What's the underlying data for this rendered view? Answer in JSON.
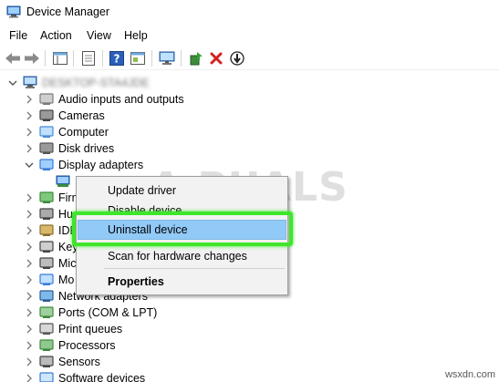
{
  "window": {
    "title": "Device Manager"
  },
  "menu": [
    "File",
    "Action",
    "View",
    "Help"
  ],
  "tree": {
    "root_label": "DESKTOP-STA4JDE",
    "items": [
      {
        "label": "Audio inputs and outputs",
        "icon": "speaker-icon"
      },
      {
        "label": "Cameras",
        "icon": "camera-icon"
      },
      {
        "label": "Computer",
        "icon": "computer-icon"
      },
      {
        "label": "Disk drives",
        "icon": "disk-drive-icon"
      },
      {
        "label": "Display adapters",
        "icon": "display-adapter-icon",
        "expanded": true
      },
      {
        "label": "Firm",
        "icon": "firmware-icon"
      },
      {
        "label": "Hu",
        "icon": "hid-icon"
      },
      {
        "label": "IDE",
        "icon": "ide-icon"
      },
      {
        "label": "Key",
        "icon": "keyboard-icon"
      },
      {
        "label": "Mic",
        "icon": "mice-icon"
      },
      {
        "label": "Mo",
        "icon": "monitor-icon"
      },
      {
        "label": "Network adapters",
        "icon": "network-adapter-icon"
      },
      {
        "label": "Ports (COM & LPT)",
        "icon": "port-icon"
      },
      {
        "label": "Print queues",
        "icon": "printer-icon"
      },
      {
        "label": "Processors",
        "icon": "processor-icon"
      },
      {
        "label": "Sensors",
        "icon": "sensor-icon"
      },
      {
        "label": "Software devices",
        "icon": "software-device-icon"
      }
    ]
  },
  "context_menu": {
    "items": [
      "Update driver",
      "Disable device",
      "Uninstall device",
      "Scan for hardware changes",
      "Properties"
    ],
    "highlighted": "Uninstall device"
  },
  "watermark": {
    "text": "A PUALS",
    "site": "wsxdn.com"
  },
  "colors": {
    "highlight": "#91c9f7",
    "callout_border": "#3ee62b",
    "menu_bg": "#f2f2f2"
  }
}
